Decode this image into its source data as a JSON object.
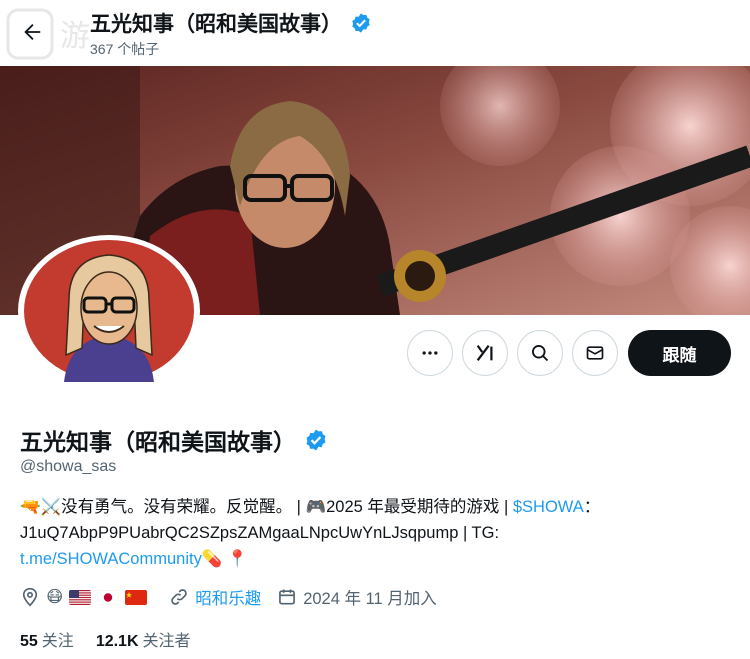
{
  "header": {
    "title": "五光知事（昭和美国故事）",
    "post_count": "367 个帖子"
  },
  "profile": {
    "name": "五光知事（昭和美国故事）",
    "handle": "@showa_sas",
    "follow_label": "跟随",
    "bio_line1_prefix": "没有勇气。没有荣耀。反觉醒。 | ",
    "bio_line1_game": "2025 年最受期待的游戏 | ",
    "bio_cashtag": "$SHOWA",
    "bio_line1_suffix": "：",
    "bio_line2": "J1uQ7AbpP9PUabrQC2SZpsZAMgaaLNpcUwYnLJsqpump | TG:",
    "bio_link": "t.me/SHOWACommunity",
    "location_flags": [
      "us",
      "jp",
      "cn"
    ],
    "website_label": "昭和乐趣",
    "joined": "2024 年 11 月加入",
    "following_count": "55",
    "following_label": "关注",
    "followers_count": "12.1K",
    "followers_label": "关注者"
  },
  "colors": {
    "accent": "#1d9bf0",
    "text": "#0f1419",
    "secondary": "#536471",
    "follow_bg": "#0f1419"
  },
  "icons": [
    "back-arrow-icon",
    "verified-badge-icon",
    "more-icon",
    "grok-icon",
    "search-icon",
    "message-icon",
    "location-icon",
    "link-icon",
    "calendar-icon"
  ]
}
